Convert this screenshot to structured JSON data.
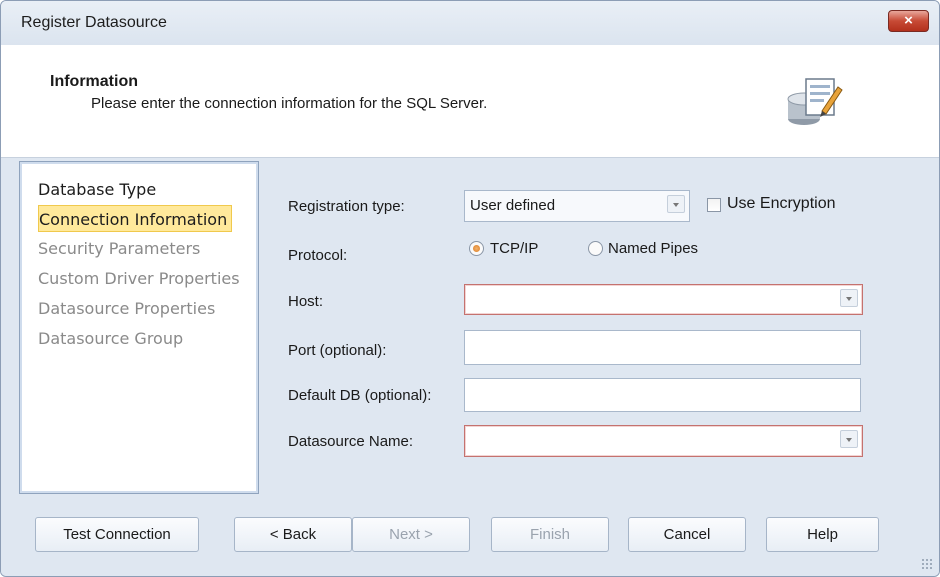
{
  "window": {
    "title": "Register Datasource",
    "close_label": "×"
  },
  "header": {
    "title": "Information",
    "subtitle": "Please enter the connection information for the SQL Server.",
    "icon": "database-form-icon"
  },
  "nav": {
    "items": [
      {
        "label": "Database Type",
        "state": "done"
      },
      {
        "label": "Connection Information",
        "state": "active"
      },
      {
        "label": "Security Parameters",
        "state": "pending"
      },
      {
        "label": "Custom Driver Properties",
        "state": "pending"
      },
      {
        "label": "Datasource Properties",
        "state": "pending"
      },
      {
        "label": "Datasource Group",
        "state": "pending"
      }
    ]
  },
  "form": {
    "registration_type": {
      "label": "Registration type:",
      "value": "User defined"
    },
    "use_encryption": {
      "label": "Use Encryption",
      "checked": false
    },
    "protocol": {
      "label": "Protocol:",
      "options": [
        {
          "label": "TCP/IP",
          "selected": true
        },
        {
          "label": "Named Pipes",
          "selected": false
        }
      ]
    },
    "host": {
      "label": "Host:",
      "value": ""
    },
    "port": {
      "label": "Port (optional):",
      "value": ""
    },
    "default_db": {
      "label": "Default DB (optional):",
      "value": ""
    },
    "datasource_name": {
      "label": "Datasource Name:",
      "value": ""
    }
  },
  "buttons": {
    "test_connection": "Test Connection",
    "back": "< Back",
    "next": "Next >",
    "finish": "Finish",
    "cancel": "Cancel",
    "help": "Help"
  },
  "colors": {
    "active_nav_bg": "#ffe99b",
    "required_border": "#c4726f",
    "close_button": "#c74a35"
  }
}
